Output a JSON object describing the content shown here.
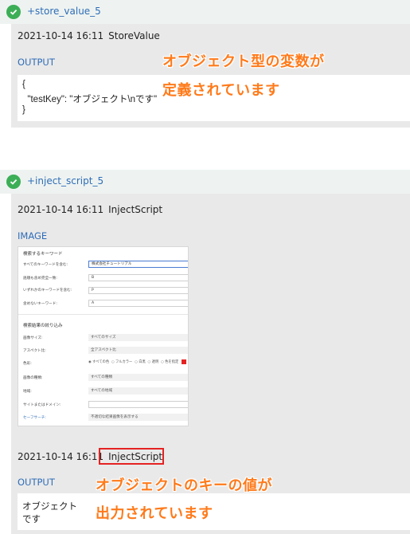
{
  "section1": {
    "title": "+store_value_5",
    "timestamp": "2021-10-14 16:11",
    "command": "StoreValue",
    "output_label": "OUTPUT",
    "output_lines": [
      "{",
      "  \"testKey\": \"オブジェクト\\nです\"",
      "}"
    ],
    "annotation_line1": "オブジェクト型の変数が",
    "annotation_line2": "定義されています"
  },
  "section2": {
    "title": "+inject_script_5",
    "timestamp": "2021-10-14 16:11",
    "command": "InjectScript",
    "image_label": "IMAGE",
    "screenshot": {
      "heading1": "検索するキーワード",
      "rows": [
        {
          "label": "すべてのキーワードを含む:",
          "value": "株式会社チュートリアル"
        },
        {
          "label": "語順も含め完全一致:",
          "value": "B"
        },
        {
          "label": "いずれかのキーワードを含む:",
          "value": "P"
        },
        {
          "label": "含めないキーワード:",
          "value": "A"
        }
      ],
      "heading2": "検索結果の絞り込み",
      "filters": [
        {
          "label": "画像サイズ:",
          "value": "すべてのサイズ"
        },
        {
          "label": "アスペクト比:",
          "value": "全アスペクト比"
        }
      ],
      "color_label": "色彩:",
      "color_options": [
        "すべての色",
        "フルカラー",
        "白黒",
        "透明",
        "色を指定"
      ],
      "filters2": [
        {
          "label": "画像の種類:",
          "value": "すべての種類"
        },
        {
          "label": "地域:",
          "value": "すべての地域"
        }
      ],
      "site_label": "サイトまたはドメイン:",
      "safesearch_label": "セーフサーチ:",
      "safesearch_value": "不適切な結果画像を表示する"
    },
    "result_timestamp": "2021-10-14 16:11",
    "result_command": "InjectScript",
    "output_label": "OUTPUT",
    "output_lines": [
      "オブジェクト",
      "です"
    ],
    "annotation_line1": "オブジェクトのキーの値が",
    "annotation_line2": "出力されています"
  },
  "colors": {
    "accent_blue": "#2f6db7",
    "check_green": "#3cae56",
    "annotation_orange": "#ff7a1a",
    "highlight_red": "#e52222"
  }
}
